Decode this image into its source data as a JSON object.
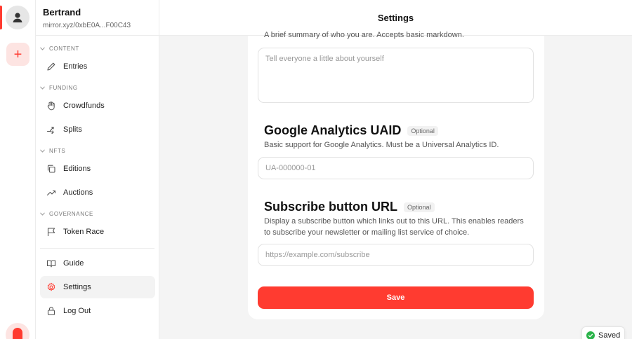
{
  "user": {
    "name": "Bertrand",
    "address": "mirror.xyz/0xbE0A...F00C43"
  },
  "rail": {
    "add_label": "+"
  },
  "sidebar": {
    "sections": [
      {
        "label": "CONTENT",
        "items": [
          {
            "label": "Entries",
            "icon": "pencil-icon"
          }
        ]
      },
      {
        "label": "FUNDING",
        "items": [
          {
            "label": "Crowdfunds",
            "icon": "hand-icon"
          },
          {
            "label": "Splits",
            "icon": "split-arrows-icon"
          }
        ]
      },
      {
        "label": "NFTS",
        "items": [
          {
            "label": "Editions",
            "icon": "copy-icon"
          },
          {
            "label": "Auctions",
            "icon": "trending-up-icon"
          }
        ]
      },
      {
        "label": "GOVERNANCE",
        "items": [
          {
            "label": "Token Race",
            "icon": "flag-icon"
          }
        ]
      }
    ],
    "footer_items": [
      {
        "label": "Guide",
        "icon": "book-icon"
      },
      {
        "label": "Settings",
        "icon": "gear-icon",
        "active": true
      },
      {
        "label": "Log Out",
        "icon": "lock-icon"
      }
    ]
  },
  "header": {
    "title": "Settings"
  },
  "form": {
    "bio_hint": "A brief summary of who you are. Accepts basic markdown.",
    "bio_placeholder": "Tell everyone a little about yourself",
    "ga": {
      "title": "Google Analytics UAID",
      "badge": "Optional",
      "description": "Basic support for Google Analytics. Must be a Universal Analytics ID.",
      "placeholder": "UA-000000-01"
    },
    "subscribe": {
      "title": "Subscribe button URL",
      "badge": "Optional",
      "description": "Display a subscribe button which links out to this URL. This enables readers to subscribe your newsletter or mailing list service of choice.",
      "placeholder": "https://example.com/subscribe"
    },
    "save_label": "Save"
  },
  "toast": {
    "label": "Saved"
  },
  "colors": {
    "accent": "#ff3b30",
    "accent_soft": "#fde4e2",
    "success": "#2bb34a"
  }
}
